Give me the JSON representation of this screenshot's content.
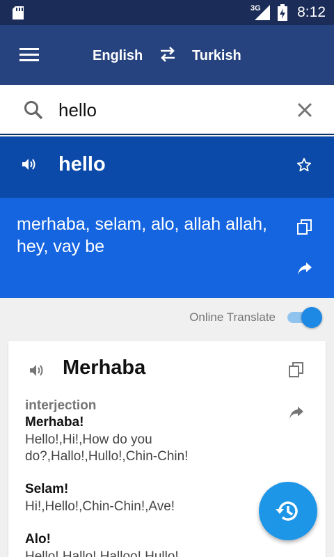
{
  "status_bar": {
    "network": "3G",
    "time": "8:12",
    "icons": [
      "sd-card-icon",
      "signal-icon",
      "battery-icon"
    ]
  },
  "app_bar": {
    "source_language": "English",
    "target_language": "Turkish",
    "icons": [
      "menu-icon",
      "swap-arrows-icon"
    ]
  },
  "search": {
    "value": "hello",
    "icons": [
      "search-icon",
      "close-icon"
    ]
  },
  "result": {
    "word": "hello",
    "translation": "merhaba, selam, alo, allah allah, hey, vay be",
    "icons": [
      "speaker-icon",
      "star-icon",
      "copy-icon",
      "share-icon"
    ]
  },
  "online_translate": {
    "label": "Online Translate",
    "enabled": true
  },
  "card": {
    "headword": "Merhaba",
    "part_of_speech": "interjection",
    "entries": [
      {
        "term": "Merhaba!",
        "definition": "Hello!,Hi!,How do you do?,Hallo!,Hullo!,Chin-Chin!"
      },
      {
        "term": "Selam!",
        "definition": "Hi!,Hello!,Chin-Chin!,Ave!"
      },
      {
        "term": "Alo!",
        "definition": "Hello!,Hallo!,Halloo!,Hullo!"
      }
    ],
    "icons": [
      "speaker-icon",
      "copy-icon",
      "share-icon"
    ]
  },
  "fab": {
    "icon": "history-icon"
  },
  "colors": {
    "status_bar": "#1a2c57",
    "app_bar": "#26437f",
    "word_bar": "#0b4aa8",
    "translation_bg": "#1565e0",
    "accent": "#1e88e5",
    "fab": "#1e96e8"
  }
}
